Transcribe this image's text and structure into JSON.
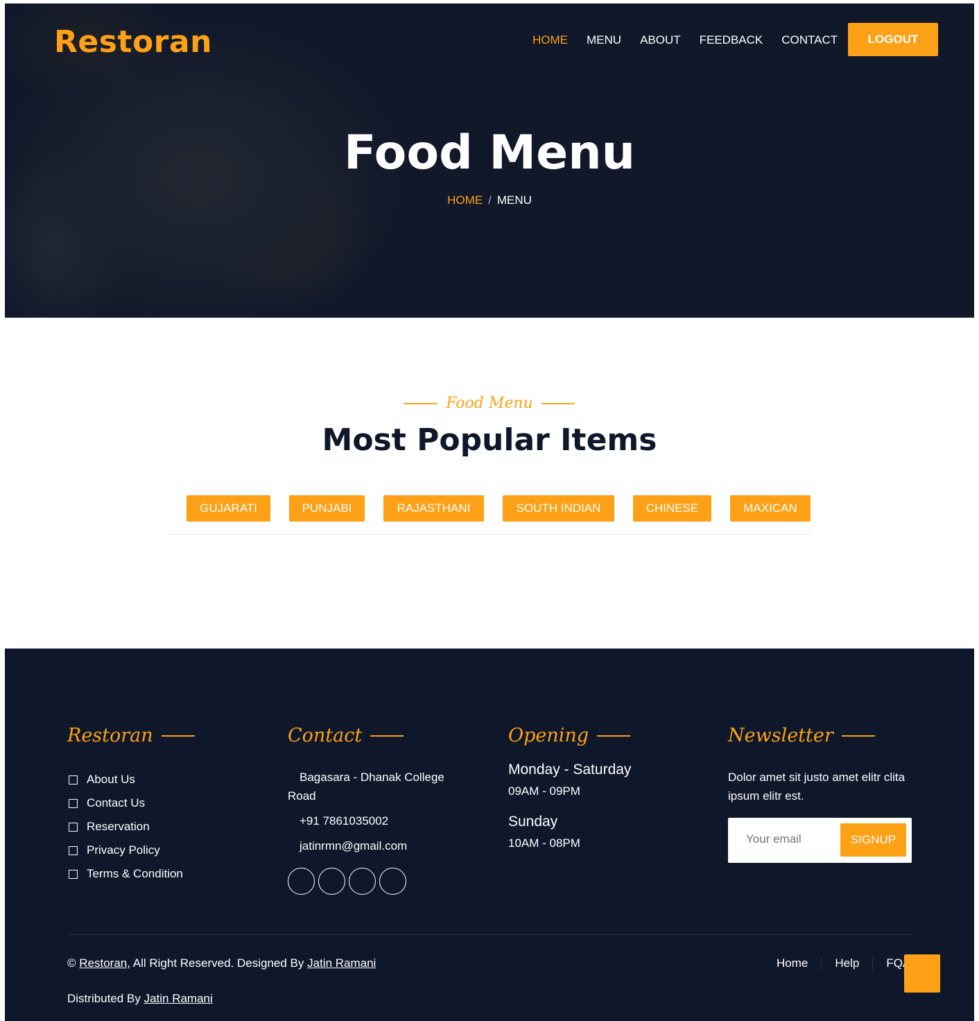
{
  "brand": "Restoran",
  "nav": {
    "items": [
      "HOME",
      "MENU",
      "ABOUT",
      "FEEDBACK",
      "CONTACT"
    ],
    "logout_label": "LOGOUT"
  },
  "hero": {
    "title": "Food Menu",
    "breadcrumb": {
      "home": "HOME",
      "separator": "/",
      "current": "MENU"
    }
  },
  "menu_section": {
    "subtitle": "Food Menu",
    "title": "Most Popular Items",
    "tabs": [
      "GUJARATI",
      "PUNJABI",
      "RAJASTHANI",
      "SOUTH INDIAN",
      "CHINESE",
      "MAXICAN"
    ]
  },
  "footer": {
    "col1": {
      "heading": "Restoran",
      "links": [
        "About Us",
        "Contact Us",
        "Reservation",
        "Privacy Policy",
        "Terms & Condition"
      ]
    },
    "contact": {
      "heading": "Contact",
      "address_line1": "Bagasara - Dhanak College",
      "address_line2": "Road",
      "phone": "+91 7861035002",
      "email": "jatinrmn@gmail.com"
    },
    "opening": {
      "heading": "Opening",
      "weekday_label": "Monday - Saturday",
      "weekday_hours": "09AM - 09PM",
      "sunday_label": "Sunday",
      "sunday_hours": "10AM - 08PM"
    },
    "newsletter": {
      "heading": "Newsletter",
      "text": "Dolor amet sit justo amet elitr clita ipsum elitr est.",
      "placeholder": "Your email",
      "button": "SIGNUP"
    },
    "copyright": {
      "prefix": "©",
      "brand_link": "Restoran",
      "middle": ", All Right Reserved. Designed By",
      "designer_link": "Jatin Ramani"
    },
    "distributed": {
      "prefix": "Distributed By",
      "link": "Jatin Ramani"
    },
    "menu": [
      "Home",
      "Help",
      "FQA"
    ]
  },
  "colors": {
    "accent": "#fea116",
    "dark": "#0f172b",
    "white": "#ffffff"
  }
}
